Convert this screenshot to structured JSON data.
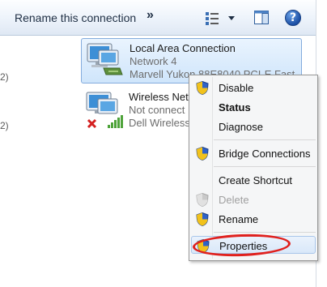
{
  "toolbar": {
    "rename_label": "Rename this connection",
    "overflow_chevron": "»",
    "view_icon": "change-view-icon",
    "preview_icon": "preview-pane-icon",
    "help_icon": "help-icon",
    "help_glyph": "?"
  },
  "left_column": {
    "row1_fragment": "2)",
    "row2_fragment": "2)"
  },
  "connections": [
    {
      "name": "Local Area Connection",
      "network": "Network 4",
      "adapter": "Marvell Yukon 88E8040 PCI-E Fast...",
      "selected": true
    },
    {
      "name": "Wireless Net",
      "network": "Not connect",
      "adapter": "Dell Wireless",
      "selected": false
    }
  ],
  "context_menu": {
    "items": [
      {
        "label": "Disable",
        "shield": true,
        "bold": false,
        "disabled": false
      },
      {
        "label": "Status",
        "shield": false,
        "bold": true,
        "disabled": false
      },
      {
        "label": "Diagnose",
        "shield": false,
        "bold": false,
        "disabled": false
      },
      {
        "label": "Bridge Connections",
        "shield": true,
        "bold": false,
        "disabled": false
      },
      {
        "label": "Create Shortcut",
        "shield": false,
        "bold": false,
        "disabled": false
      },
      {
        "label": "Delete",
        "shield": true,
        "bold": false,
        "disabled": true
      },
      {
        "label": "Rename",
        "shield": true,
        "bold": false,
        "disabled": false
      },
      {
        "label": "Properties",
        "shield": true,
        "bold": false,
        "disabled": false,
        "highlighted": true
      }
    ]
  },
  "colors": {
    "highlight_oval": "#e0201d",
    "selection_fill": "#cfe5fb",
    "shield_blue": "#2f62c8",
    "shield_yellow": "#f2c21b"
  }
}
